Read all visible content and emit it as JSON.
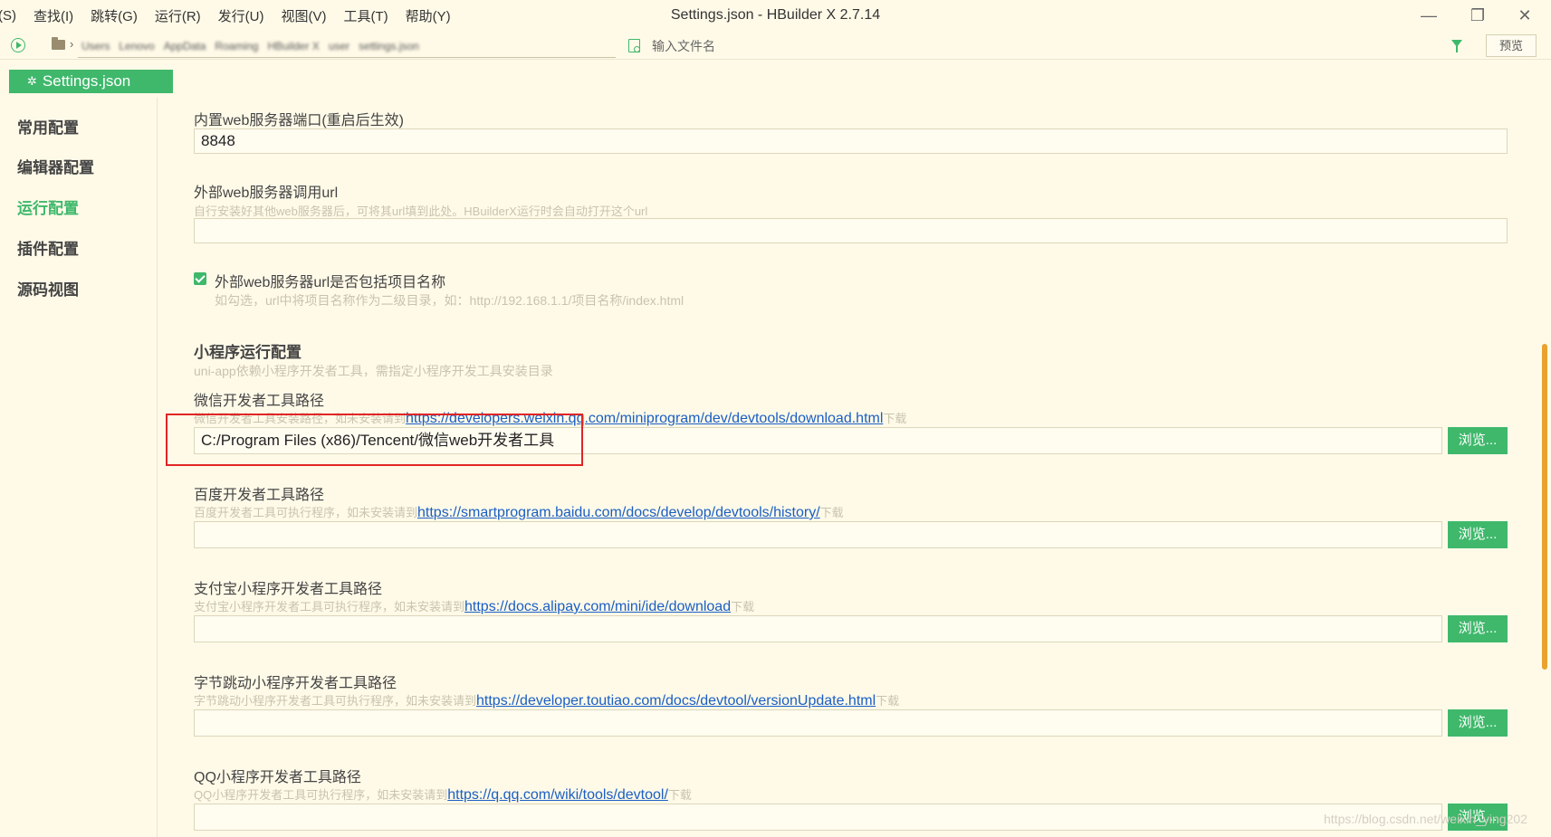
{
  "menu": [
    "(S)",
    "查找(I)",
    "跳转(G)",
    "运行(R)",
    "发行(U)",
    "视图(V)",
    "工具(T)",
    "帮助(Y)"
  ],
  "window": {
    "title": "Settings.json - HBuilder X 2.7.14",
    "minimize": "—",
    "maximize": "❐",
    "close": "✕"
  },
  "toolbar": {
    "breadcrumb": [
      "Users",
      "Lenovo",
      "AppData",
      "Roaming",
      "HBuilder X",
      "user",
      "settings.json"
    ],
    "file_search_placeholder": "输入文件名",
    "preview_label": "预览"
  },
  "file_tab": {
    "label": "Settings.json",
    "icon": "gear-icon"
  },
  "sidebar": {
    "items": [
      {
        "label": "常用配置",
        "active": false
      },
      {
        "label": "编辑器配置",
        "active": false
      },
      {
        "label": "运行配置",
        "active": true
      },
      {
        "label": "插件配置",
        "active": false
      },
      {
        "label": "源码视图",
        "active": false
      }
    ]
  },
  "settings": {
    "web_port": {
      "label": "内置web服务器端口(重启后生效)",
      "value": "8848"
    },
    "web_url": {
      "label": "外部web服务器调用url",
      "desc": "自行安装好其他web服务器后，可将其url填到此处。HBuilderX运行时会自动打开这个url",
      "value": ""
    },
    "include_project_name": {
      "label": "外部web服务器url是否包括项目名称",
      "desc": "如勾选，url中将项目名称作为二级目录，如：http://192.168.1.1/项目名称/index.html",
      "checked": true
    },
    "miniprogram": {
      "title": "小程序运行配置",
      "desc": "uni-app依赖小程序开发者工具，需指定小程序开发工具安装目录"
    },
    "browse_label": "浏览...",
    "download_suffix": "下载",
    "tools": [
      {
        "label": "微信开发者工具路径",
        "desc_prefix": "微信开发者工具安装路径，如未安装请到",
        "link": "https://developers.weixin.qq.com/miniprogram/dev/devtools/download.html",
        "value": "C:/Program Files (x86)/Tencent/微信web开发者工具"
      },
      {
        "label": "百度开发者工具路径",
        "desc_prefix": "百度开发者工具可执行程序，如未安装请到",
        "link": "https://smartprogram.baidu.com/docs/develop/devtools/history/",
        "value": ""
      },
      {
        "label": "支付宝小程序开发者工具路径",
        "desc_prefix": "支付宝小程序开发者工具可执行程序，如未安装请到",
        "link": "https://docs.alipay.com/mini/ide/download",
        "value": ""
      },
      {
        "label": "字节跳动小程序开发者工具路径",
        "desc_prefix": "字节跳动小程序开发者工具可执行程序，如未安装请到",
        "link": "https://developer.toutiao.com/docs/devtool/versionUpdate.html",
        "value": ""
      },
      {
        "label": "QQ小程序开发者工具路径",
        "desc_prefix": "QQ小程序开发者工具可执行程序，如未安装请到",
        "link": "https://q.qq.com/wiki/tools/devtool/",
        "value": ""
      }
    ]
  },
  "watermark": "https://blog.csdn.net/weixin_ying202",
  "colors": {
    "accent": "#3fb86b",
    "background": "#fffae8",
    "highlight": "#e02525",
    "link": "#1a5ec4"
  }
}
